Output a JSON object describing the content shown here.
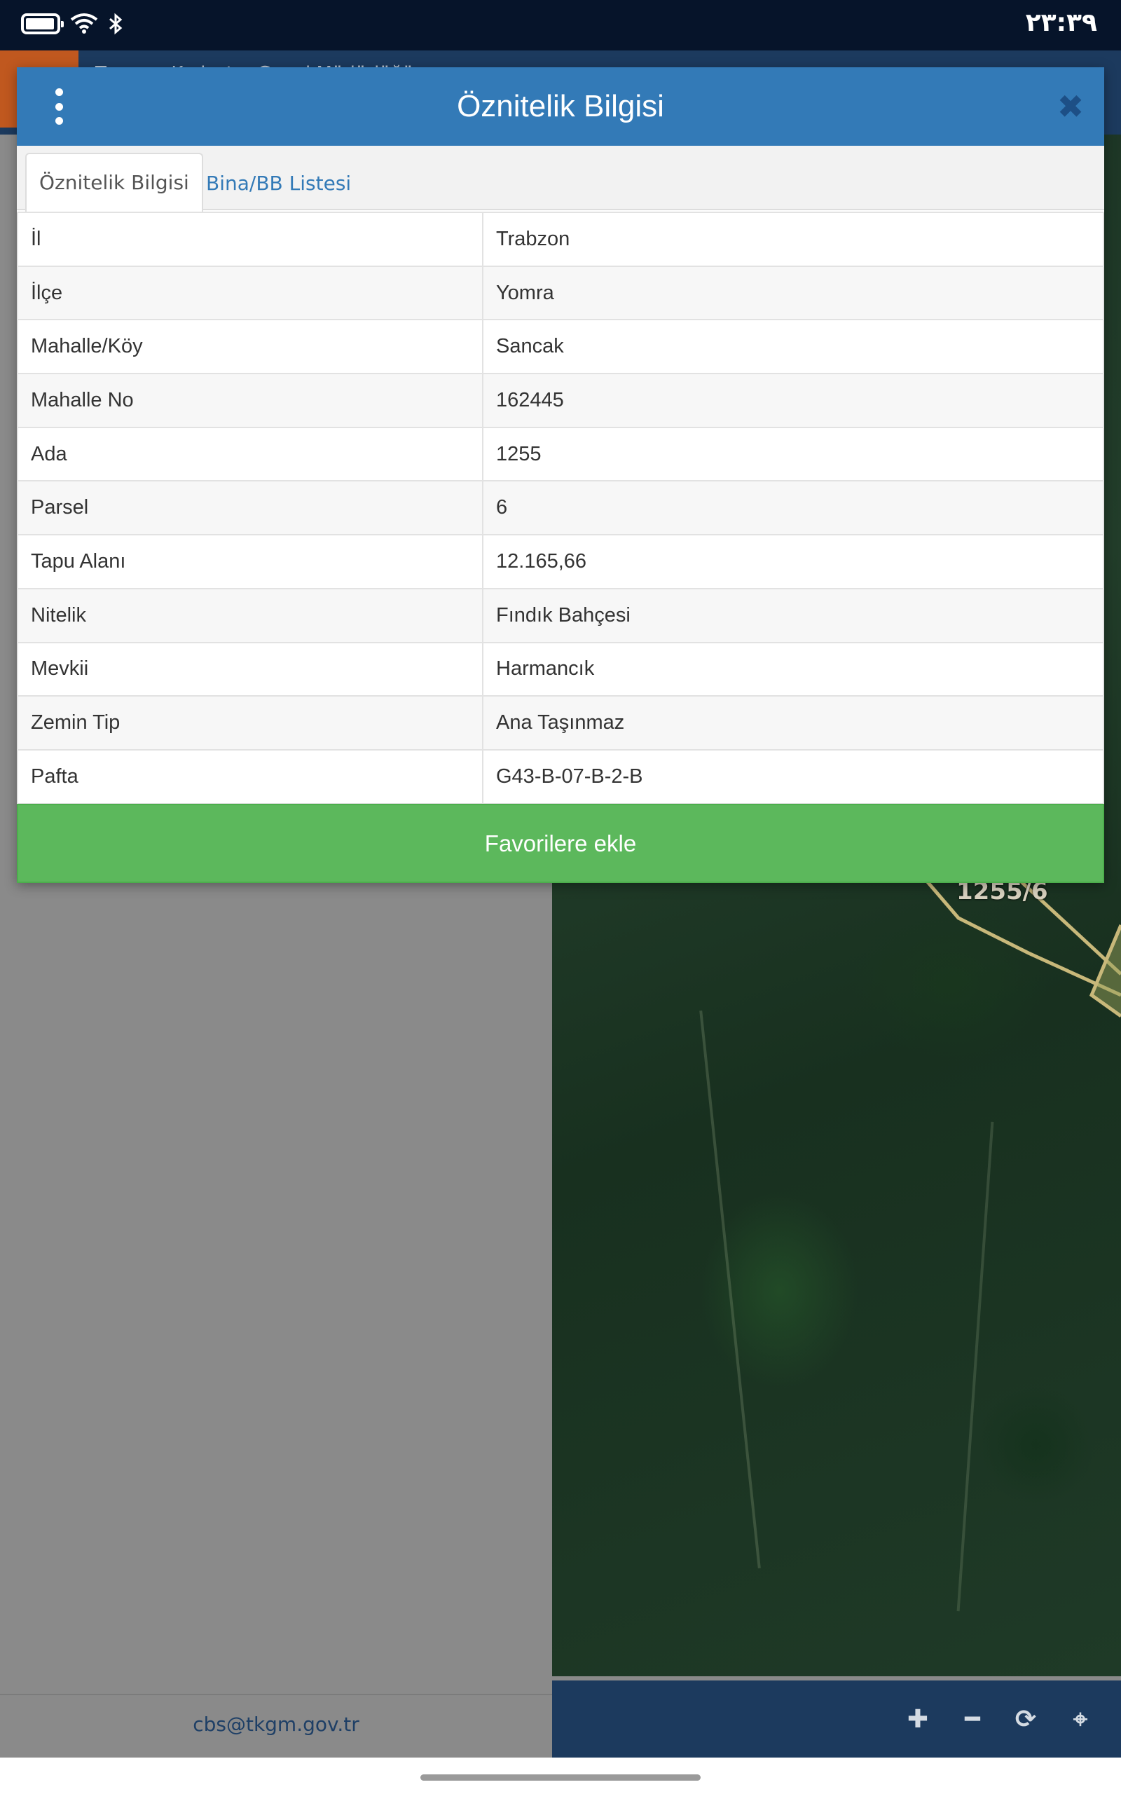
{
  "status_bar": {
    "time": "۲۳:۳۹",
    "icons": [
      "battery-icon",
      "wifi-icon",
      "bluetooth-icon"
    ]
  },
  "app": {
    "header_title": "Tapu ve Kadastro Genel Müdürlüğü",
    "footer_email": "cbs@tkgm.gov.tr",
    "map_parcel_label": "1255/6",
    "map_tools": [
      "zoom-in-icon",
      "zoom-out-icon",
      "refresh-icon",
      "locate-icon"
    ]
  },
  "modal": {
    "title": "Öznitelik Bilgisi",
    "tabs": [
      {
        "label": "Öznitelik Bilgisi",
        "active": true
      },
      {
        "label": "Bina/BB Listesi",
        "active": false
      }
    ],
    "rows": [
      {
        "key": "İl",
        "value": "Trabzon"
      },
      {
        "key": "İlçe",
        "value": "Yomra"
      },
      {
        "key": "Mahalle/Köy",
        "value": "Sancak"
      },
      {
        "key": "Mahalle No",
        "value": "162445"
      },
      {
        "key": "Ada",
        "value": "1255"
      },
      {
        "key": "Parsel",
        "value": "6"
      },
      {
        "key": "Tapu Alanı",
        "value": "12.165,66"
      },
      {
        "key": "Nitelik",
        "value": "Fındık Bahçesi"
      },
      {
        "key": "Mevkii",
        "value": "Harmancık"
      },
      {
        "key": "Zemin Tip",
        "value": "Ana Taşınmaz"
      },
      {
        "key": "Pafta",
        "value": "G43-B-07-B-2-B"
      }
    ],
    "favorite_button": "Favorilere ekle"
  },
  "colors": {
    "header_blue": "#337ab7",
    "button_green": "#5cb85c",
    "link_blue": "#337ab7",
    "app_navy": "#1c3a5e"
  }
}
